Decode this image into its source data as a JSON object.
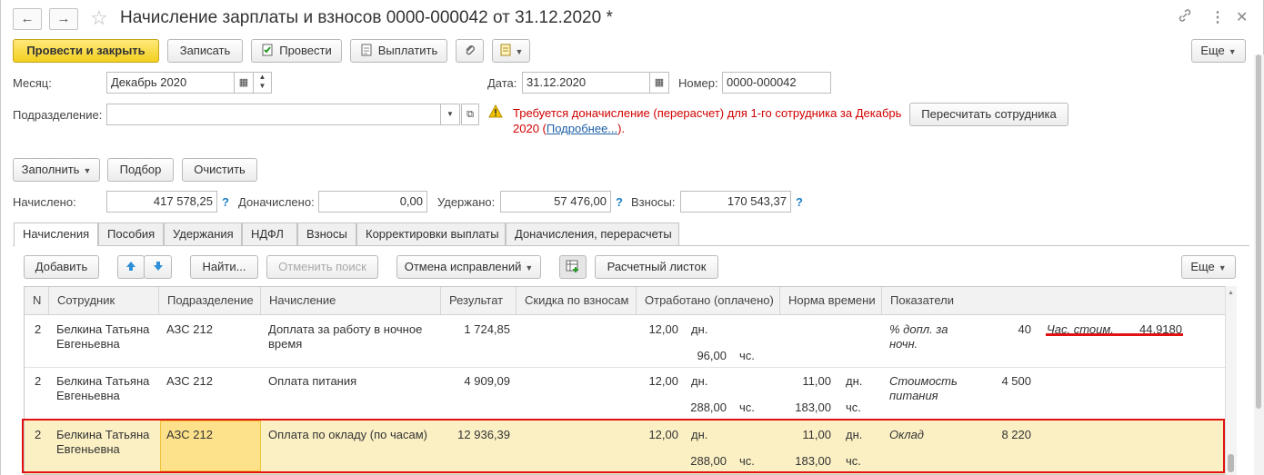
{
  "window": {
    "title": "Начисление зарплаты и взносов 0000-000042 от 31.12.2020 *"
  },
  "toolbar": {
    "post_close": "Провести и закрыть",
    "save": "Записать",
    "post": "Провести",
    "pay": "Выплатить",
    "more": "Еще"
  },
  "form": {
    "month_label": "Месяц:",
    "month_value": "Декабрь 2020",
    "date_label": "Дата:",
    "date_value": "31.12.2020",
    "number_label": "Номер:",
    "number_value": "0000-000042",
    "division_label": "Подразделение:",
    "division_value": "",
    "warning_text": "Требуется доначисление (перерасчет) для 1-го сотрудника за Декабрь 2020 (",
    "warning_link": "Подробнее...",
    "warning_end": ").",
    "recalc_button": "Пересчитать сотрудника"
  },
  "actions": {
    "fill": "Заполнить",
    "pick": "Подбор",
    "clear": "Очистить"
  },
  "totals": {
    "accrued_label": "Начислено:",
    "accrued_value": "417 578,25",
    "extra_label": "Доначислено:",
    "extra_value": "0,00",
    "withheld_label": "Удержано:",
    "withheld_value": "57 476,00",
    "contrib_label": "Взносы:",
    "contrib_value": "170 543,37",
    "help": "?"
  },
  "tabs": [
    {
      "label": "Начисления"
    },
    {
      "label": "Пособия"
    },
    {
      "label": "Удержания"
    },
    {
      "label": "НДФЛ"
    },
    {
      "label": "Взносы"
    },
    {
      "label": "Корректировки выплаты"
    },
    {
      "label": "Доначисления, перерасчеты"
    }
  ],
  "tab_toolbar": {
    "add": "Добавить",
    "find": "Найти...",
    "cancel_search": "Отменить поиск",
    "cancel_fix": "Отмена исправлений",
    "payslip": "Расчетный листок",
    "more": "Еще"
  },
  "table": {
    "columns": [
      "N",
      "Сотрудник",
      "Подразделение",
      "Начисление",
      "Результат",
      "Скидка по взносам",
      "Отработано (оплачено)",
      "Норма времени",
      "Показатели"
    ],
    "rows": [
      {
        "n": "2",
        "employee_1": "Белкина Татьяна",
        "employee_2": "Евгеньевна",
        "division": "АЗС 212",
        "accrual_1": "Доплата за работу в ночное",
        "accrual_2": "время",
        "result": "1 724,85",
        "worked_1": "12,00",
        "unit_1": "дн.",
        "worked_2": "96,00",
        "unit_2": "чс.",
        "norm_1": "",
        "norm_unit_1": "",
        "norm_2": "",
        "norm_unit_2": "",
        "ind1_name_1": "% допл. за",
        "ind1_name_2": "ночн.",
        "ind1_value": "40",
        "ind2_name": "Час. стоим.",
        "ind2_value": "44,9180"
      },
      {
        "n": "2",
        "employee_1": "Белкина Татьяна",
        "employee_2": "Евгеньевна",
        "division": "АЗС 212",
        "accrual_1": "Оплата питания",
        "accrual_2": "",
        "result": "4 909,09",
        "worked_1": "12,00",
        "unit_1": "дн.",
        "worked_2": "288,00",
        "unit_2": "чс.",
        "norm_1": "11,00",
        "norm_unit_1": "дн.",
        "norm_2": "183,00",
        "norm_unit_2": "чс.",
        "ind1_name_1": "Стоимость",
        "ind1_name_2": "питания",
        "ind1_value": "4 500",
        "ind2_name": "",
        "ind2_value": ""
      },
      {
        "n": "2",
        "employee_1": "Белкина Татьяна",
        "employee_2": "Евгеньевна",
        "division": "АЗС 212",
        "accrual_1": "Оплата по окладу (по часам)",
        "accrual_2": "",
        "result": "12 936,39",
        "worked_1": "12,00",
        "unit_1": "дн.",
        "worked_2": "288,00",
        "unit_2": "чс.",
        "norm_1": "11,00",
        "norm_unit_1": "дн.",
        "norm_2": "183,00",
        "norm_unit_2": "чс.",
        "ind1_name_1": "Оклад",
        "ind1_name_2": "",
        "ind1_value": "8 220",
        "ind2_name": "",
        "ind2_value": ""
      }
    ]
  }
}
